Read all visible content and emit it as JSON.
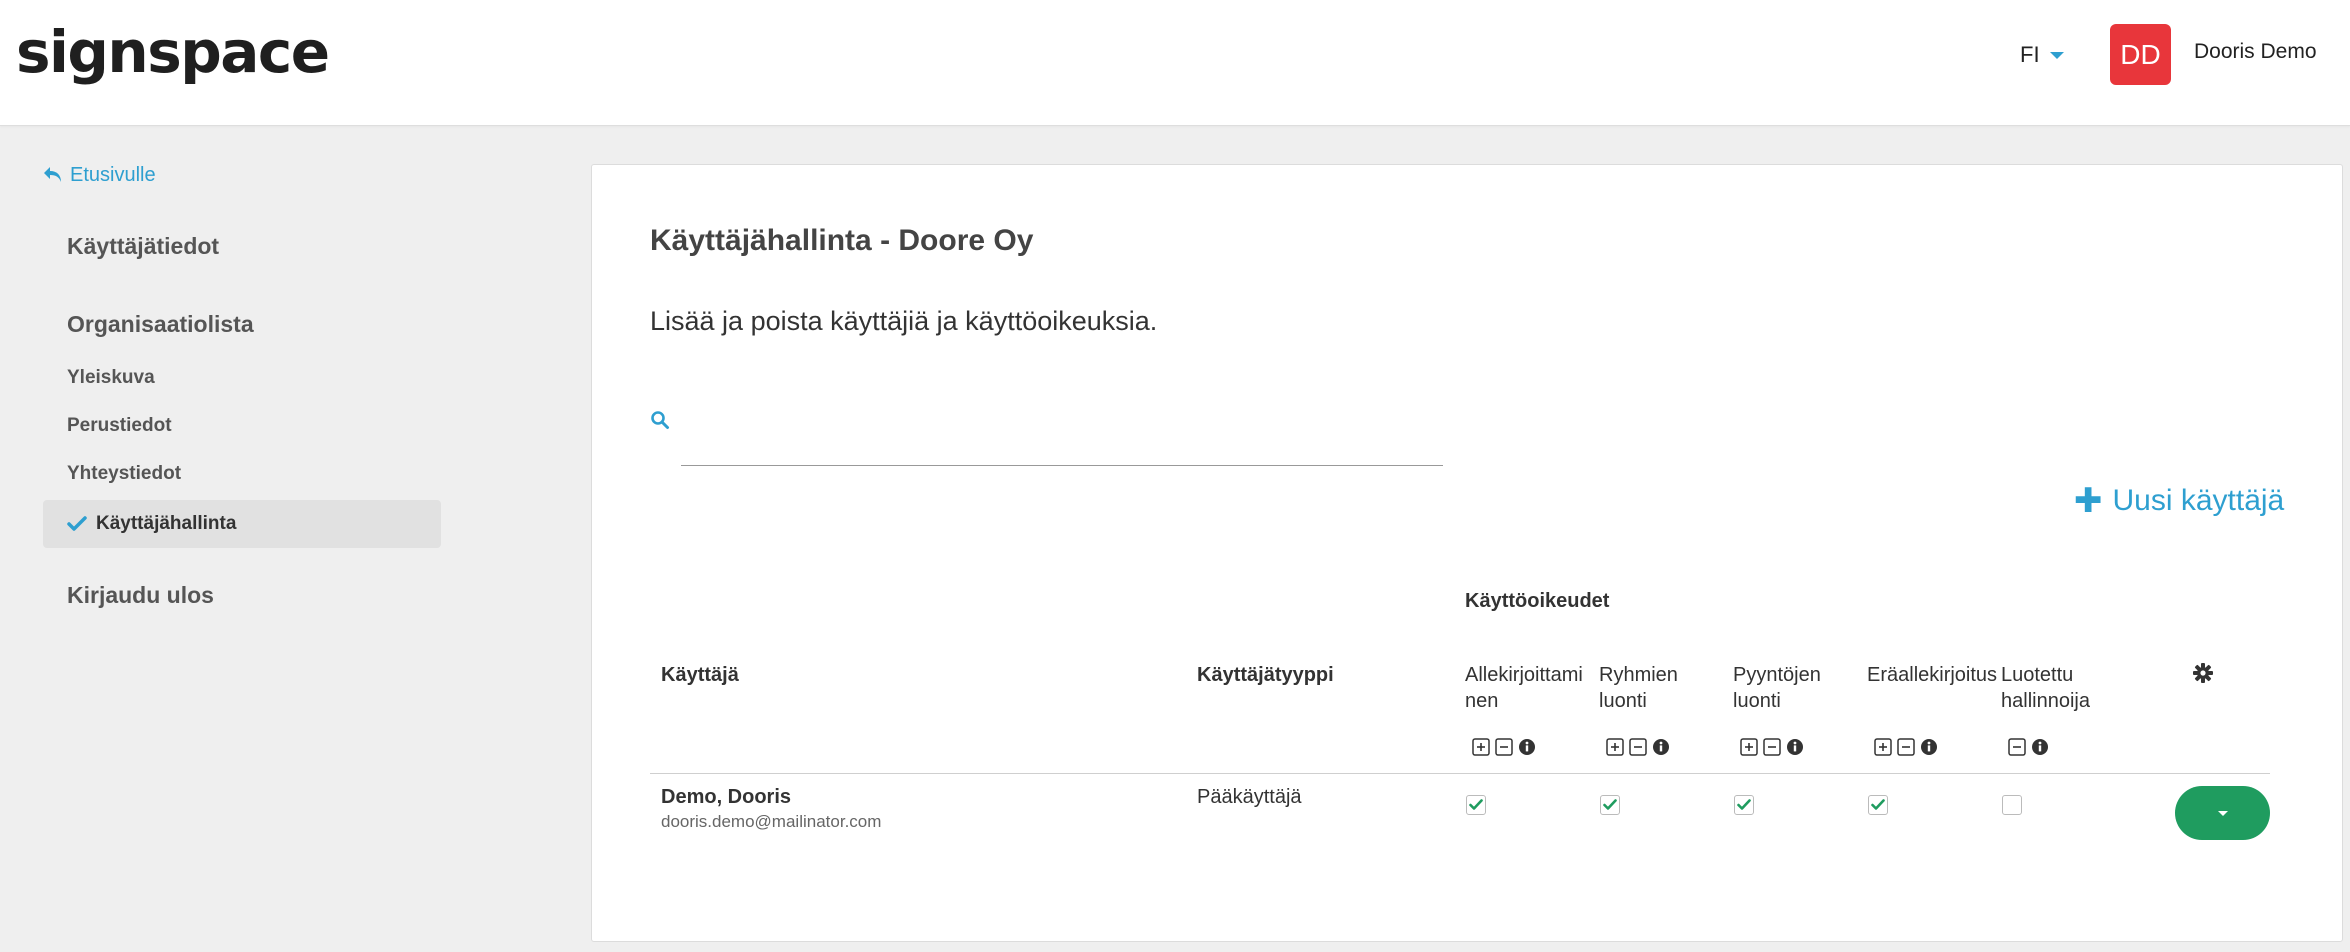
{
  "header": {
    "logo": "signspace",
    "language": "FI",
    "avatar_initials": "DD",
    "user_name": "Dooris Demo"
  },
  "sidebar": {
    "back_label": "Etusivulle",
    "sections": [
      {
        "label": "Käyttäjätiedot"
      },
      {
        "label": "Organisaatiolista"
      }
    ],
    "sub_items": [
      {
        "label": "Yleiskuva"
      },
      {
        "label": "Perustiedot"
      },
      {
        "label": "Yhteystiedot"
      },
      {
        "label": "Käyttäjähallinta",
        "active": true
      }
    ],
    "logout_label": "Kirjaudu ulos"
  },
  "main": {
    "title": "Käyttäjähallinta - Doore Oy",
    "description": "Lisää ja poista käyttäjiä ja käyttöoikeuksia.",
    "search": {
      "value": "",
      "placeholder": ""
    },
    "new_user_label": "Uusi käyttäjä",
    "table": {
      "permissions_group_label": "Käyttöoikeudet",
      "columns": {
        "user": "Käyttäjä",
        "user_type": "Käyttäjätyyppi",
        "perm1_line1": "Allekirjoittami",
        "perm1_line2": "nen",
        "perm2_line1": "Ryhmien",
        "perm2_line2": "luonti",
        "perm3_line1": "Pyyntöjen",
        "perm3_line2": "luonti",
        "perm4_line1": "Eräallekirjoitus",
        "perm5_line1": "Luotettu",
        "perm5_line2": "hallinnoija"
      },
      "rows": [
        {
          "name": "Demo, Dooris",
          "email": "dooris.demo@mailinator.com",
          "type": "Pääkäyttäjä",
          "permissions": [
            true,
            true,
            true,
            true,
            false
          ]
        }
      ]
    }
  },
  "colors": {
    "accent": "#2e9fd0",
    "avatar": "#e8363b",
    "action": "#1f9c5f",
    "check": "#1f9c5f"
  }
}
